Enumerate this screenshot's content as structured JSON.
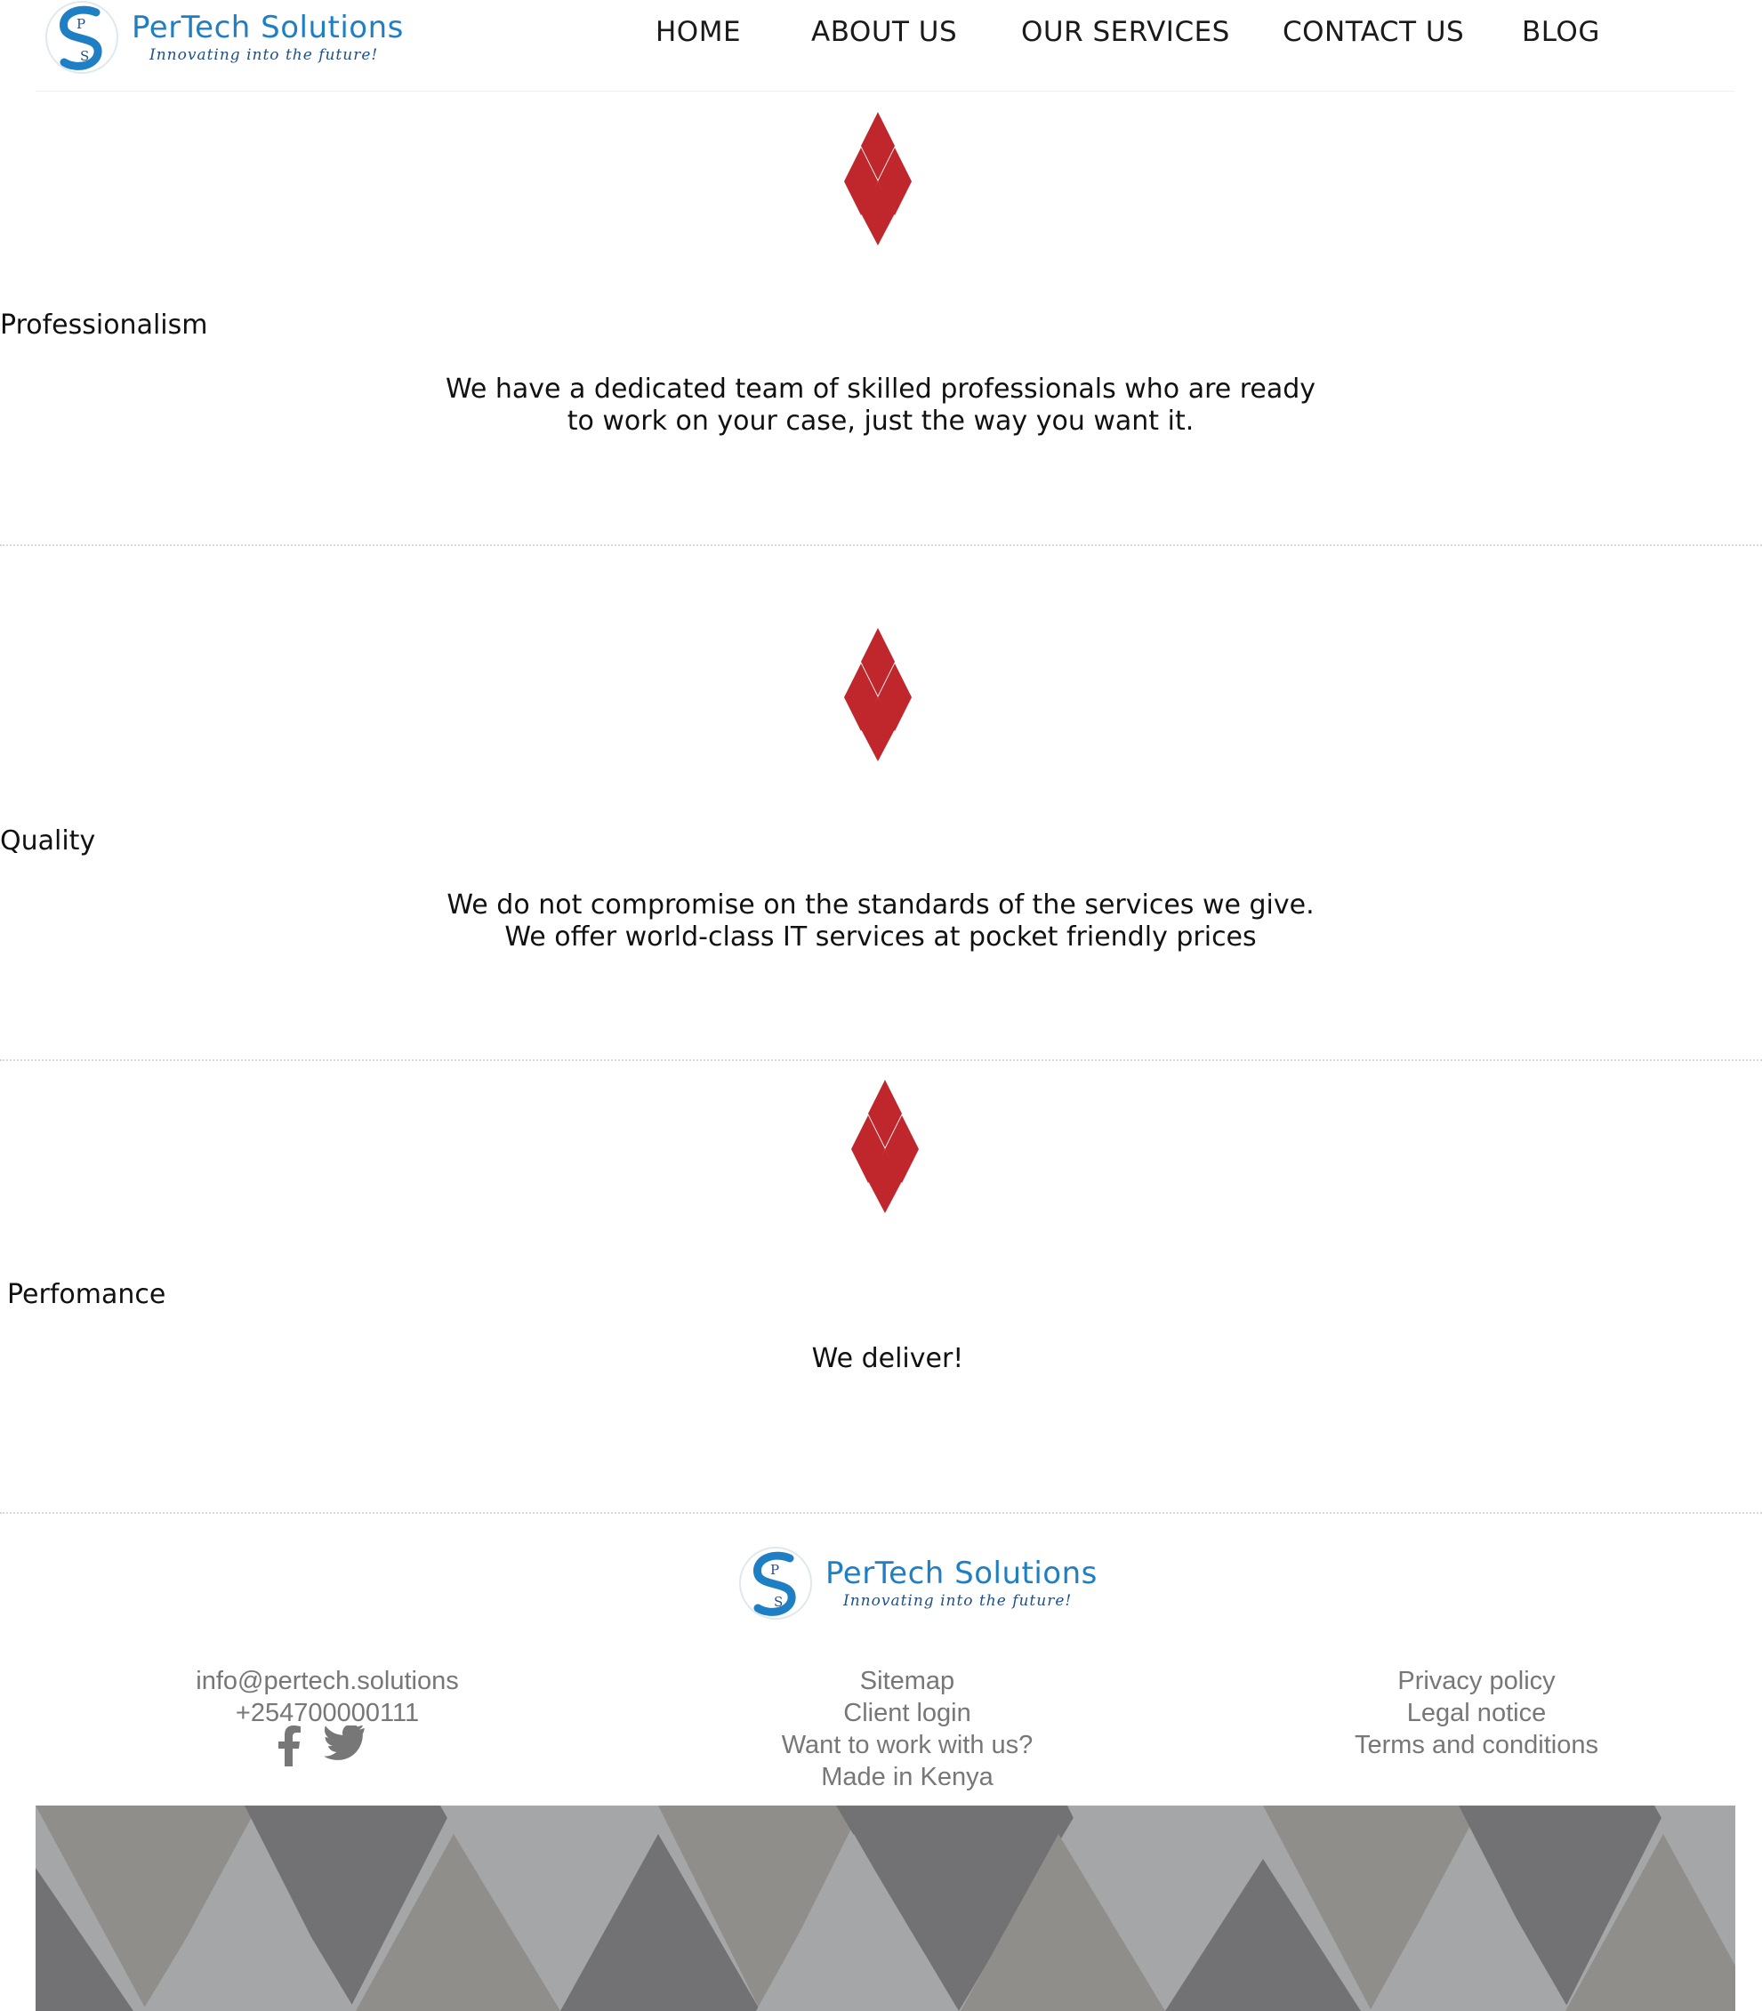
{
  "header": {
    "logo": {
      "brand": "PerTech Solutions",
      "tagline": "Innovating into the future!"
    },
    "nav": [
      {
        "label": "HOME"
      },
      {
        "label": "ABOUT US"
      },
      {
        "label": "OUR SERVICES"
      },
      {
        "label": "CONTACT US"
      },
      {
        "label": "BLOG"
      }
    ]
  },
  "features": [
    {
      "title": "Professionalism",
      "description": "We have a dedicated team of skilled professionals who are ready to work on your case, just the way you want it.",
      "icon": "red-diamonds-icon"
    },
    {
      "title": "Quality",
      "description": "We do not compromise on the standards of the services we give. We offer world-class IT services at pocket friendly prices",
      "icon": "red-diamonds-icon"
    },
    {
      "title": "Perfomance",
      "description": "We deliver!",
      "icon": "red-diamonds-icon"
    }
  ],
  "footer": {
    "logo": {
      "brand": "PerTech Solutions",
      "tagline": "Innovating into the future!"
    },
    "contact": {
      "email": "info@pertech.solutions",
      "phone": "+254700000111"
    },
    "links_middle": [
      "Sitemap",
      "Client login",
      "Want to work with us?",
      "Made in Kenya"
    ],
    "links_right": [
      "Privacy policy",
      "Legal notice",
      "Terms and conditions"
    ],
    "social_icons": [
      "facebook-icon",
      "twitter-icon"
    ]
  },
  "colors": {
    "accent_red": "#c0272d",
    "brand_blue": "#1f7fc4",
    "footer_text": "#777777"
  }
}
